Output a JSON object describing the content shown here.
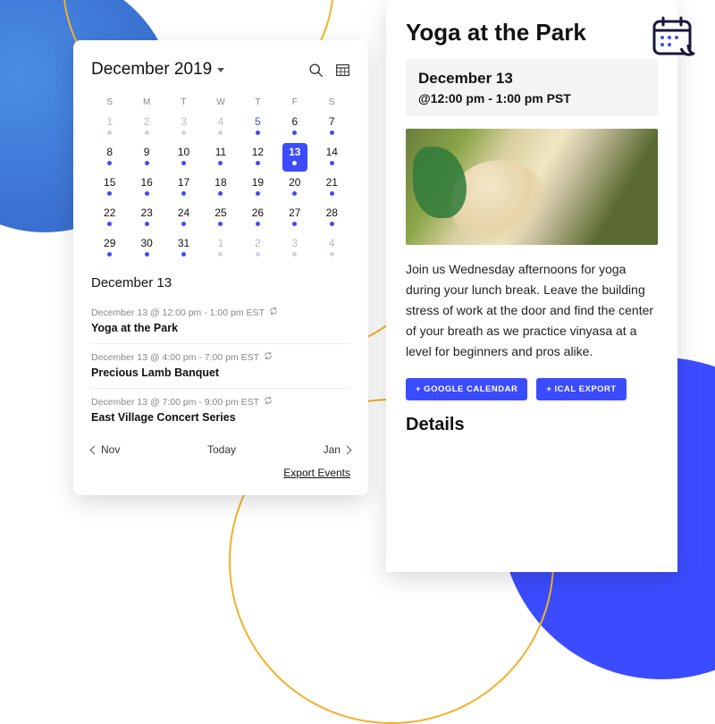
{
  "calendar": {
    "title": "December 2019",
    "dow": [
      "S",
      "M",
      "T",
      "W",
      "T",
      "F",
      "S"
    ],
    "weeks": [
      [
        {
          "n": 1,
          "muted": true,
          "dot": true
        },
        {
          "n": 2,
          "muted": true,
          "dot": true
        },
        {
          "n": 3,
          "muted": true,
          "dot": true
        },
        {
          "n": 4,
          "muted": true,
          "dot": true
        },
        {
          "n": 5,
          "blue": true,
          "dot": true
        },
        {
          "n": 6,
          "dot": true
        },
        {
          "n": 7,
          "dot": true
        }
      ],
      [
        {
          "n": 8,
          "dot": true
        },
        {
          "n": 9,
          "dot": true
        },
        {
          "n": 10,
          "dot": true
        },
        {
          "n": 11,
          "dot": true
        },
        {
          "n": 12,
          "dot": true
        },
        {
          "n": 13,
          "selected": true,
          "dot": true
        },
        {
          "n": 14,
          "dot": true
        }
      ],
      [
        {
          "n": 15,
          "dot": true
        },
        {
          "n": 16,
          "dot": true
        },
        {
          "n": 17,
          "dot": true
        },
        {
          "n": 18,
          "dot": true
        },
        {
          "n": 19,
          "dot": true
        },
        {
          "n": 20,
          "dot": true
        },
        {
          "n": 21,
          "dot": true
        }
      ],
      [
        {
          "n": 22,
          "dot": true
        },
        {
          "n": 23,
          "dot": true
        },
        {
          "n": 24,
          "dot": true
        },
        {
          "n": 25,
          "dot": true
        },
        {
          "n": 26,
          "dot": true
        },
        {
          "n": 27,
          "dot": true
        },
        {
          "n": 28,
          "dot": true
        }
      ],
      [
        {
          "n": 29,
          "dot": true
        },
        {
          "n": 30,
          "dot": true
        },
        {
          "n": 31,
          "dot": true
        },
        {
          "n": 1,
          "muted": true,
          "dot": true
        },
        {
          "n": 2,
          "muted": true,
          "dot": true
        },
        {
          "n": 3,
          "muted": true,
          "dot": true
        },
        {
          "n": 4,
          "muted": true,
          "dot": true
        }
      ]
    ],
    "selected_date_label": "December 13",
    "events": [
      {
        "time": "December 13 @ 12:00 pm - 1:00 pm EST",
        "title": "Yoga at the Park",
        "recurring": true
      },
      {
        "time": "December 13 @ 4:00 pm - 7:00 pm EST",
        "title": "Precious Lamb Banquet",
        "recurring": true
      },
      {
        "time": "December 13 @ 7:00 pm - 9:00 pm EST",
        "title": "East Village Concert Series",
        "recurring": true
      }
    ],
    "nav": {
      "prev": "Nov",
      "today": "Today",
      "next": "Jan"
    },
    "export_label": "Export Events"
  },
  "detail": {
    "title": "Yoga at the Park",
    "date": "December 13",
    "time": "@12:00 pm - 1:00 pm PST",
    "description": "Join us Wednesday afternoons for yoga during your lunch break.  Leave the building stress of work at the door and find the center of your breath as we practice vinyasa at a level for beginners and pros alike.",
    "actions": {
      "gcal": "+ GOOGLE CALENDAR",
      "ical": "+ ICAL EXPORT"
    },
    "details_heading": "Details"
  }
}
